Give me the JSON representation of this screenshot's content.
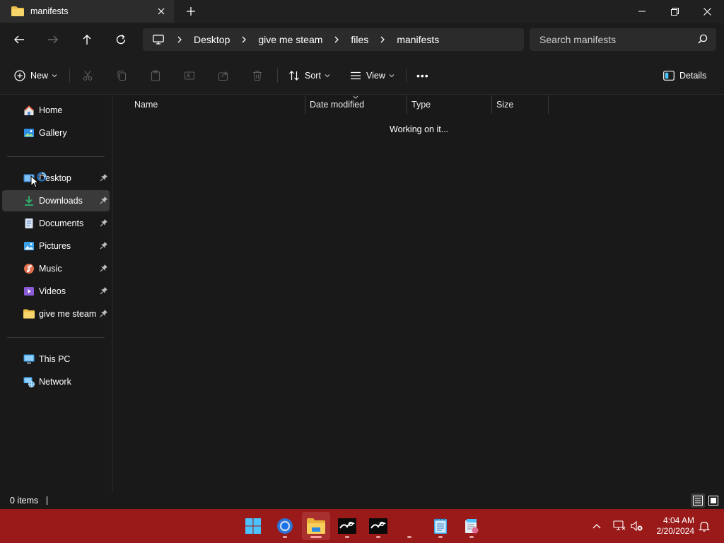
{
  "window": {
    "tab_title": "manifests",
    "new_tab_label": "+"
  },
  "navigation": {
    "breadcrumbs": [
      "Desktop",
      "give me steam",
      "files",
      "manifests"
    ],
    "search_placeholder": "Search manifests"
  },
  "commandbar": {
    "new_label": "New",
    "sort_label": "Sort",
    "view_label": "View",
    "more_label": "•••",
    "details_label": "Details"
  },
  "sidebar": {
    "quick": [
      {
        "label": "Home",
        "icon": "home-icon"
      },
      {
        "label": "Gallery",
        "icon": "gallery-icon"
      }
    ],
    "pinned": [
      {
        "label": "Desktop",
        "icon": "desktop-icon"
      },
      {
        "label": "Downloads",
        "icon": "downloads-icon",
        "selected": true
      },
      {
        "label": "Documents",
        "icon": "documents-icon"
      },
      {
        "label": "Pictures",
        "icon": "pictures-icon"
      },
      {
        "label": "Music",
        "icon": "music-icon"
      },
      {
        "label": "Videos",
        "icon": "videos-icon"
      },
      {
        "label": "give me steam",
        "icon": "folder-icon"
      }
    ],
    "devices": [
      {
        "label": "This PC",
        "icon": "this-pc-icon"
      },
      {
        "label": "Network",
        "icon": "network-icon"
      }
    ]
  },
  "content": {
    "columns": [
      "Name",
      "Date modified",
      "Type",
      "Size"
    ],
    "loading_text": "Working on it..."
  },
  "statusbar": {
    "item_count": "0 items"
  },
  "taskbar": {
    "apps": [
      "start-icon",
      "chrome-icon",
      "file-explorer-icon",
      "steam-icon",
      "steam-icon",
      "notepad-icon",
      "installer-icon"
    ],
    "time": "4:04 AM",
    "date": "2/20/2024"
  },
  "colors": {
    "background": "#191919",
    "taskbar": "#9a1a1a",
    "selected": "#3a3a3a",
    "accent": "#4cc2ff"
  }
}
